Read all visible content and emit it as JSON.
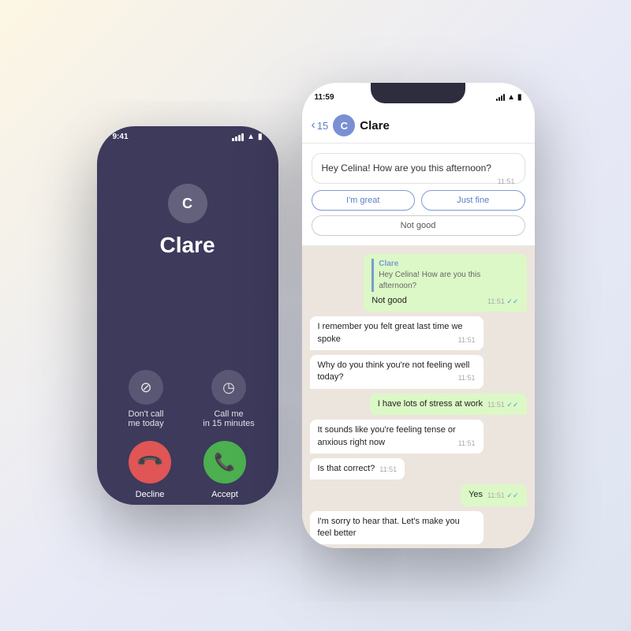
{
  "left_phone": {
    "status_time": "9:41",
    "app_name": "Clare",
    "app_logo_letter": "C",
    "no_call_label": "Don't call\nme today",
    "later_call_label": "Call me\nin 15 minutes",
    "decline_label": "Decline",
    "accept_label": "Accept",
    "no_call_icon": "🚫",
    "clock_icon": "◷",
    "decline_icon": "📞",
    "accept_icon": "📞"
  },
  "right_phone": {
    "status_time": "11:59",
    "back_count": "15",
    "chat_name": "Clare",
    "avatar_letter": "C",
    "first_msg": "Hey Celina! How are you this afternoon?",
    "first_msg_time": "11:51",
    "option_great": "I'm great",
    "option_fine": "Just fine",
    "option_not_good": "Not good",
    "quoted_sender": "Clare",
    "quoted_text": "Hey Celina! How are you this afternoon?",
    "sent_not_good": "Not good",
    "sent_not_good_time": "11:51",
    "msg_remember": "I remember you felt great last time we spoke",
    "msg_remember_time": "11:51",
    "msg_why": "Why do you think you're not feeling well today?",
    "msg_why_time": "11:51",
    "sent_stress": "I have lots of stress at work",
    "sent_stress_time": "11:51",
    "msg_tense": "It sounds like you're feeling tense or anxious right now",
    "msg_tense_time": "11:51",
    "msg_correct": "Is that correct?",
    "msg_correct_time": "11:51",
    "sent_yes": "Yes",
    "sent_yes_time": "11:51",
    "msg_sorry": "I'm sorry to hear that. Let's make you feel better"
  }
}
